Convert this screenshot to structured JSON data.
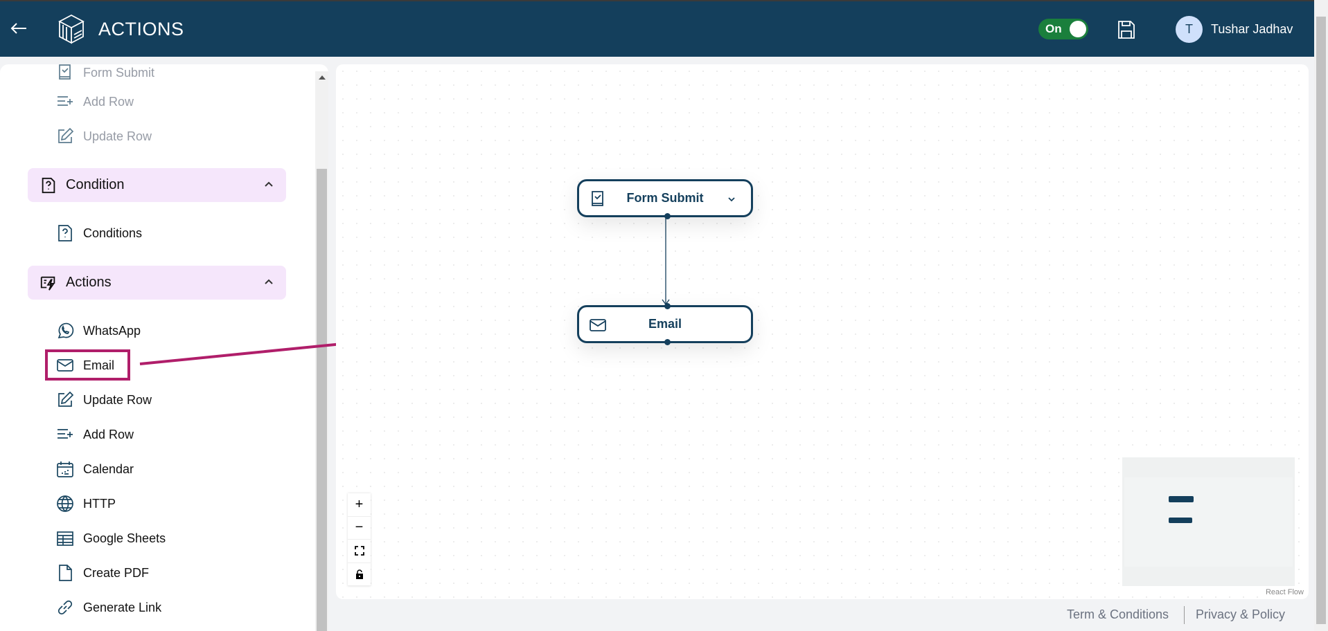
{
  "header": {
    "title": "ACTIONS",
    "toggle_label": "On",
    "toggle_on": true,
    "avatar_initial": "T",
    "user_name": "Tushar Jadhav",
    "accent": "#143f5c"
  },
  "sidebar": {
    "top_items": [
      {
        "label": "Form Submit",
        "icon": "form-icon"
      },
      {
        "label": "Add Row",
        "icon": "add-row-icon"
      },
      {
        "label": "Update Row",
        "icon": "edit-icon"
      }
    ],
    "groups": [
      {
        "label": "Condition",
        "icon": "question-file-icon",
        "expanded": true,
        "items": [
          {
            "label": "Conditions",
            "icon": "question-file-icon"
          }
        ]
      },
      {
        "label": "Actions",
        "icon": "lightning-icon",
        "expanded": true,
        "items": [
          {
            "label": "WhatsApp",
            "icon": "whatsapp-icon"
          },
          {
            "label": "Email",
            "icon": "mail-icon"
          },
          {
            "label": "Update Row",
            "icon": "edit-icon"
          },
          {
            "label": "Add Row",
            "icon": "add-row-icon"
          },
          {
            "label": "Calendar",
            "icon": "calendar-icon"
          },
          {
            "label": "HTTP",
            "icon": "globe-icon"
          },
          {
            "label": "Google Sheets",
            "icon": "table-icon"
          },
          {
            "label": "Create PDF",
            "icon": "file-icon"
          },
          {
            "label": "Generate Link",
            "icon": "link-icon"
          }
        ]
      }
    ],
    "highlight_color": "#b01e6a"
  },
  "flow": {
    "nodes": [
      {
        "label": "Form Submit",
        "icon": "form-icon"
      },
      {
        "label": "Email",
        "icon": "mail-icon"
      }
    ],
    "attribution": "React Flow"
  },
  "footer": {
    "terms": "Term & Conditions",
    "privacy": "Privacy & Policy"
  }
}
